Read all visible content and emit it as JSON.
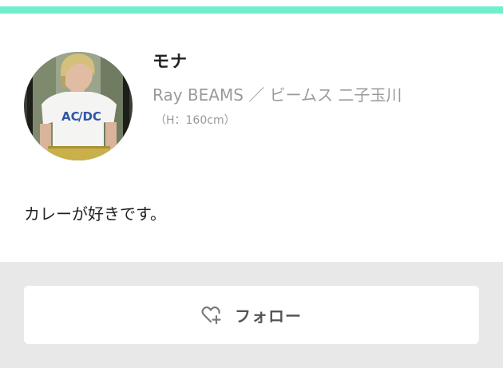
{
  "theme": {
    "accent_color": "#6ef0cc",
    "background_gray": "#e8e8e8"
  },
  "profile": {
    "avatar_icon": "staff-photo",
    "name": "モナ",
    "shop": "Ray BEAMS ／ ビームス 二子玉川",
    "height": "（H：160cm）",
    "bio": "カレーが好きです。"
  },
  "actions": {
    "follow_icon": "heart-plus-icon",
    "follow_label": "フォロー"
  }
}
